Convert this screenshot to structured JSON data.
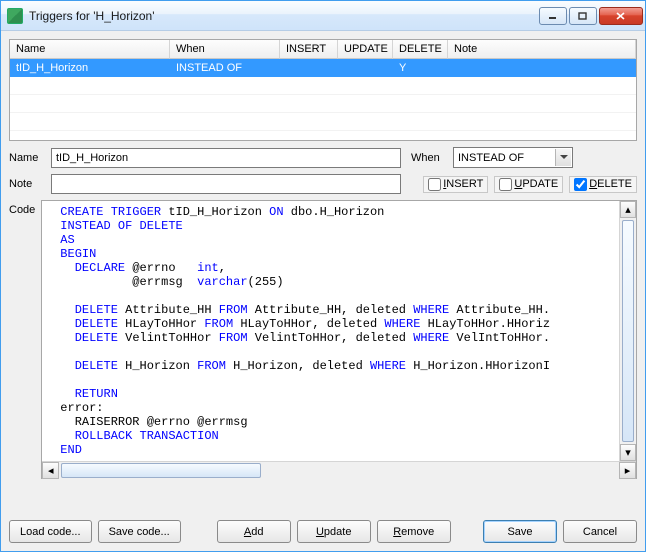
{
  "window": {
    "title": "Triggers for 'H_Horizon'"
  },
  "grid": {
    "columns": [
      "Name",
      "When",
      "INSERT",
      "UPDATE",
      "DELETE",
      "Note"
    ],
    "rows": [
      {
        "name": "tID_H_Horizon",
        "when": "INSTEAD OF",
        "insert": "",
        "update": "",
        "delete": "Y",
        "note": "",
        "selected": true
      }
    ]
  },
  "form": {
    "name_label": "Name",
    "name_value": "tID_H_Horizon",
    "note_label": "Note",
    "note_value": "",
    "when_label": "When",
    "when_value": "INSTEAD OF",
    "insert_label": "INSERT",
    "update_label": "UPDATE",
    "delete_label": "DELETE",
    "insert_checked": false,
    "update_checked": false,
    "delete_checked": true,
    "code_label": "Code"
  },
  "code": {
    "tokens": [
      [
        {
          "t": "CREATE TRIGGER",
          "k": 1
        },
        {
          "t": " tID_H_Horizon "
        },
        {
          "t": "ON",
          "k": 1
        },
        {
          "t": " dbo.H_Horizon"
        }
      ],
      [
        {
          "t": "INSTEAD OF DELETE",
          "k": 1
        }
      ],
      [
        {
          "t": "AS",
          "k": 1
        }
      ],
      [
        {
          "t": "BEGIN",
          "k": 1
        }
      ],
      [
        {
          "t": "  "
        },
        {
          "t": "DECLARE",
          "k": 1
        },
        {
          "t": " @errno   "
        },
        {
          "t": "int",
          "k": 1
        },
        {
          "t": ","
        }
      ],
      [
        {
          "t": "          @errmsg  "
        },
        {
          "t": "varchar",
          "k": 1
        },
        {
          "t": "(255)"
        }
      ],
      [
        {
          "t": ""
        }
      ],
      [
        {
          "t": "  "
        },
        {
          "t": "DELETE",
          "k": 1
        },
        {
          "t": " Attribute_HH "
        },
        {
          "t": "FROM",
          "k": 1
        },
        {
          "t": " Attribute_HH, deleted "
        },
        {
          "t": "WHERE",
          "k": 1
        },
        {
          "t": " Attribute_HH."
        }
      ],
      [
        {
          "t": "  "
        },
        {
          "t": "DELETE",
          "k": 1
        },
        {
          "t": " HLayToHHor "
        },
        {
          "t": "FROM",
          "k": 1
        },
        {
          "t": " HLayToHHor, deleted "
        },
        {
          "t": "WHERE",
          "k": 1
        },
        {
          "t": " HLayToHHor.HHoriz"
        }
      ],
      [
        {
          "t": "  "
        },
        {
          "t": "DELETE",
          "k": 1
        },
        {
          "t": " VelintToHHor "
        },
        {
          "t": "FROM",
          "k": 1
        },
        {
          "t": " VelintToHHor, deleted "
        },
        {
          "t": "WHERE",
          "k": 1
        },
        {
          "t": " VelIntToHHor."
        }
      ],
      [
        {
          "t": ""
        }
      ],
      [
        {
          "t": "  "
        },
        {
          "t": "DELETE",
          "k": 1
        },
        {
          "t": " H_Horizon "
        },
        {
          "t": "FROM",
          "k": 1
        },
        {
          "t": " H_Horizon, deleted "
        },
        {
          "t": "WHERE",
          "k": 1
        },
        {
          "t": " H_Horizon.HHorizonI"
        }
      ],
      [
        {
          "t": ""
        }
      ],
      [
        {
          "t": "  "
        },
        {
          "t": "RETURN",
          "k": 1
        }
      ],
      [
        {
          "t": "error:"
        }
      ],
      [
        {
          "t": "  RAISERROR @errno @errmsg"
        }
      ],
      [
        {
          "t": "  "
        },
        {
          "t": "ROLLBACK TRANSACTION",
          "k": 1
        }
      ],
      [
        {
          "t": "END",
          "k": 1
        }
      ]
    ]
  },
  "buttons": {
    "load": "Load code...",
    "save_code": "Save code...",
    "add": "Add",
    "update": "Update",
    "remove": "Remove",
    "save": "Save",
    "cancel": "Cancel"
  }
}
